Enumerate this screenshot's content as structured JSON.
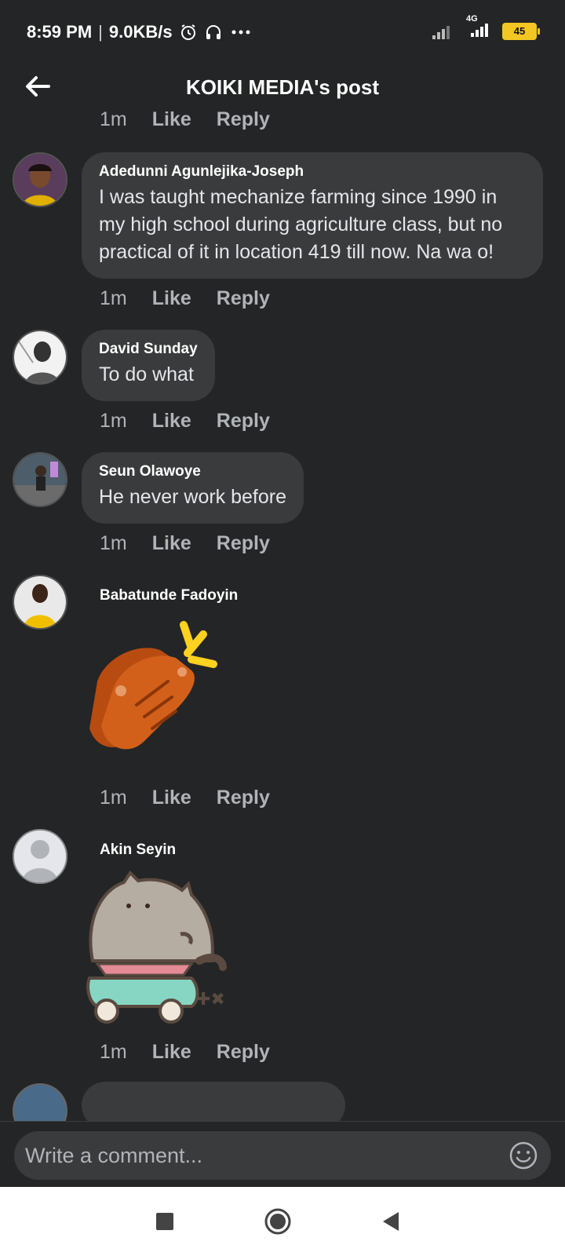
{
  "status_bar": {
    "time": "8:59 PM",
    "separator": "|",
    "speed": "9.0KB/s",
    "network": "4G",
    "battery": "45",
    "icons": [
      "alarm-icon",
      "headphones-icon",
      "more-icon",
      "signal-icon",
      "signal-4g-icon",
      "battery-icon"
    ]
  },
  "header": {
    "title": "KOIKI MEDIA's post",
    "back_icon": "arrow-left-icon"
  },
  "partial_top_actions": {
    "time": "1m",
    "like": "Like",
    "reply": "Reply"
  },
  "comments": [
    {
      "author": "Adedunni Agunlejika-Joseph",
      "text": "I was taught mechanize farming since 1990 in my high school during agriculture class, but no practical of it in location 419 till now. Na wa o!",
      "time": "1m",
      "like": "Like",
      "reply": "Reply"
    },
    {
      "author": "David Sunday",
      "text": "To do what",
      "time": "1m",
      "like": "Like",
      "reply": "Reply"
    },
    {
      "author": "Seun Olawoye",
      "text": "He never work before",
      "time": "1m",
      "like": "Like",
      "reply": "Reply"
    },
    {
      "author": "Babatunde Fadoyin",
      "sticker": "clapping-hands-sticker",
      "time": "1m",
      "like": "Like",
      "reply": "Reply"
    },
    {
      "author": "Akin Seyin",
      "sticker": "pusheen-cat-scooter-sticker",
      "time": "1m",
      "like": "Like",
      "reply": "Reply"
    }
  ],
  "composer": {
    "placeholder": "Write a comment...",
    "emoji_icon": "smiley-icon"
  },
  "nav_bar": {
    "icons": [
      "recent-apps-icon",
      "home-icon",
      "back-icon"
    ]
  },
  "colors": {
    "background": "#242526",
    "bubble": "#3a3b3c",
    "text": "#e4e6eb",
    "muted": "#b0b3b8",
    "battery": "#f3c623"
  }
}
